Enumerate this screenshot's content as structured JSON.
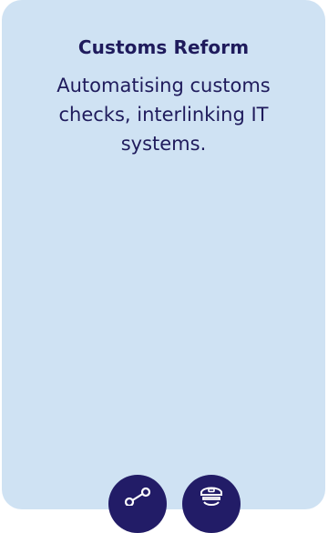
{
  "card": {
    "title": "Customs Reform",
    "description": "Automatising customs checks, interlinking IT systems.",
    "background_color": "#cfe2f3",
    "text_color": "#1f1b5c"
  },
  "actions": [
    {
      "name": "share",
      "icon": "share-icon"
    },
    {
      "name": "customs-officer",
      "icon": "customs-officer-icon"
    }
  ],
  "button_color": "#221c67"
}
